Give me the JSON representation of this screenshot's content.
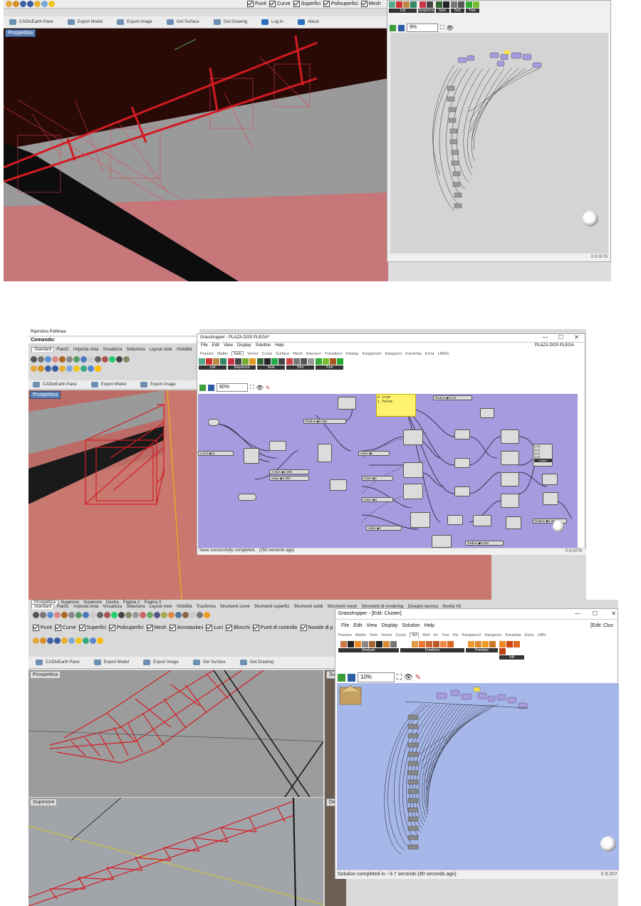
{
  "section1": {
    "rhino_checkboxes": [
      "Punti",
      "Curve",
      "Superfici",
      "Polisuperfici",
      "Mesh"
    ],
    "plugin_toolbar": [
      "CADtoEarth Pane",
      "Export Model",
      "Export Image",
      "Get Surface",
      "Get Drawing",
      "Log In",
      "About"
    ],
    "viewport_label": "Prospettica",
    "gh": {
      "groups": [
        "List",
        "Sequence",
        "Sets",
        "Text",
        "Tree"
      ],
      "zoom": "9%",
      "version": "0.9.0076"
    }
  },
  "section2": {
    "title_left": "Ripristino Polilinea",
    "command_label": "Comando:",
    "rhino_tabs": [
      "Standard",
      "PianiC",
      "Imposta vista",
      "Visualizza",
      "Seleziona",
      "Layout viste",
      "Visibilità"
    ],
    "plugin_toolbar": [
      "CADtoEarth Pane",
      "Export Model",
      "Export Image"
    ],
    "viewport_label": "Prospettica",
    "gh": {
      "title": "Grasshopper - PLAZA DOS PLEGA*",
      "doc_name": "PLAZA DOS PLEGA",
      "menu": [
        "File",
        "Edit",
        "View",
        "Display",
        "Solution",
        "Help"
      ],
      "tabs": [
        "Params",
        "Maths",
        "Sets",
        "Vector",
        "Curve",
        "Surface",
        "Mesh",
        "Intersect",
        "Transform",
        "Display",
        "Kangaroo2",
        "Kangaroo",
        "Karamba",
        "Extra",
        "LMNts"
      ],
      "active_tab": "Sets",
      "groups": [
        "List",
        "Sequence",
        "Sets",
        "Text",
        "Tree"
      ],
      "zoom": "80%",
      "panel_lines": [
        "0 true",
        "1 false"
      ],
      "sliders": {
        "radius_top": "Radius",
        "radius_top_val": "0.141",
        "radius_left": "Radius",
        "radius_left_val": "0.335",
        "count": "count",
        "count_val": "34",
        "xsize": "X Size",
        "xsize_val": "1.000",
        "value": "value",
        "value_val": "1.000",
        "index1": "index",
        "index1_val": "1",
        "index2": "index",
        "index2_val": "2",
        "index3": "index",
        "index3_val": "3",
        "index4": "index",
        "index4_val": "4",
        "radius_right": "Radius",
        "radius_right_val": "0.05",
        "radius_bottom": "Radius",
        "radius_bottom_val": "0.025"
      },
      "tree_items": [
        "{0;0}",
        "{0;1}",
        "{0;2}",
        "{0;3}"
      ],
      "flatten_label": "Flatten",
      "status": "Save successfully completed... (250 seconds ago)",
      "version": "0.9.0076"
    }
  },
  "section3": {
    "viewport_tabs": [
      "Prospettica",
      "Superiore",
      "Superiore",
      "Destra",
      "Pagina 2",
      "Pagina 3"
    ],
    "rhino_tabs": [
      "Standard",
      "PianiC",
      "Imposta vista",
      "Visualizza",
      "Seleziona",
      "Layout viste",
      "Visibilità",
      "Trasforma",
      "Strumenti curve",
      "Strumenti superfici",
      "Strumenti solidi",
      "Strumenti mesh",
      "Strumenti di rendering",
      "Disegno tecnico",
      "Novità V5"
    ],
    "rhino_checkboxes": [
      "Punti",
      "Curve",
      "Superfici",
      "Polisuperfici",
      "Mesh",
      "Annotazioni",
      "Luci",
      "Blocchi",
      "Punti di controllo",
      "Nuvole di p"
    ],
    "plugin_toolbar": [
      "CADtoEarth Pane",
      "Export Model",
      "Export Image",
      "Get Surface",
      "Get Drawing"
    ],
    "viewport_top": "Prospettica",
    "viewport_bottom": "Superiore",
    "viewport_side1": "Sup",
    "viewport_side2": "De",
    "gh": {
      "title": "Grasshopper - [Edit: Cluster]",
      "edit_label": "[Edit: Clus",
      "menu": [
        "File",
        "Edit",
        "View",
        "Display",
        "Solution",
        "Help"
      ],
      "tabs": [
        "Params",
        "Maths",
        "Sets",
        "Vector",
        "Curve",
        "Srf",
        "Msh",
        "Int",
        "Trns",
        "Dis",
        "Kangaroo2",
        "Kangaroo",
        "Karamba",
        "Extra",
        "LMN"
      ],
      "active_tab": "Srf",
      "groups": [
        "Analysis",
        "Freeform",
        "Primitive",
        "Util"
      ],
      "zoom": "10%",
      "status": "Solution completed in ~3.7 seconds (80 seconds ago)",
      "version": "0.9.007"
    }
  },
  "colors": {
    "gh_purple": "#a79bdf",
    "gh_blue": "#a6b7ea",
    "truss_red": "#d41d24",
    "floor_pink": "#c9787b"
  }
}
